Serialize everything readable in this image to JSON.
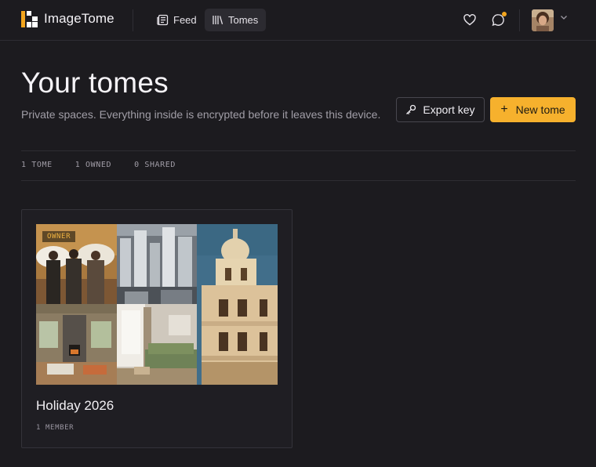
{
  "app": {
    "brand": "ImageTome"
  },
  "nav": [
    {
      "label": "Feed",
      "icon": "feed-icon",
      "active": false
    },
    {
      "label": "Tomes",
      "icon": "tomes-icon",
      "active": true
    }
  ],
  "header_actions": {
    "favorites_icon": "heart-icon",
    "messages_icon": "chat-bubble-icon",
    "has_unread": true,
    "account_chevron_icon": "chevron-down-icon"
  },
  "page": {
    "title": "Your tomes",
    "subtitle": "Private spaces. Everything inside is encrypted before it leaves this device.",
    "export_label": "Export key",
    "export_icon": "key-icon",
    "new_label": "New tome",
    "new_icon": "plus-icon"
  },
  "stats": [
    "1 TOME",
    "1 OWNED",
    "0 SHARED"
  ],
  "tomes": [
    {
      "name": "Holiday 2026",
      "role_badge": "OWNER",
      "members": "1 MEMBER",
      "cover_photos": [
        "people-with-umbrellas",
        "city-skyscrapers",
        "living-room-fireplace",
        "living-room-green-sofa",
        "ornate-building-tower"
      ]
    }
  ],
  "colors": {
    "background": "#1c1b1f",
    "accent": "#f6b12d",
    "badge_text": "#f2b440",
    "notification_dot": "#f3a51d"
  }
}
